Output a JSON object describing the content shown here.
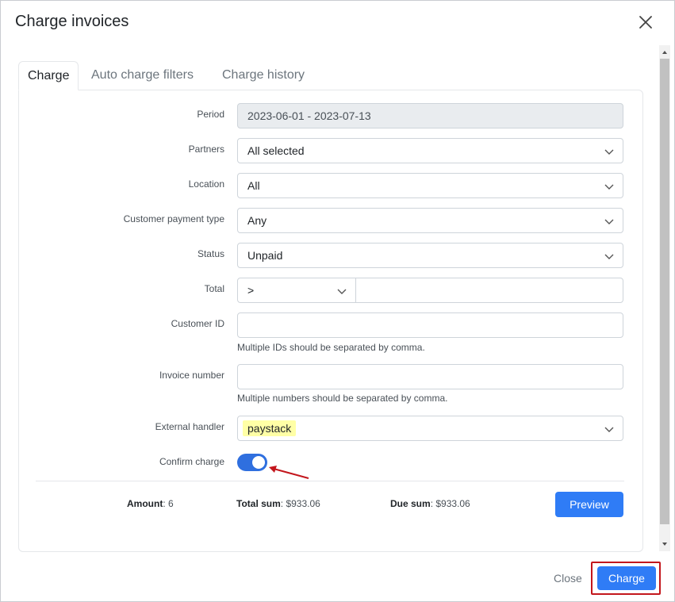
{
  "dialog": {
    "title": "Charge invoices",
    "close_icon": "close-icon"
  },
  "tabs": [
    {
      "label": "Charge",
      "active": true
    },
    {
      "label": "Auto charge filters",
      "active": false
    },
    {
      "label": "Charge history",
      "active": false
    }
  ],
  "form": {
    "period": {
      "label": "Period",
      "value": "2023-06-01 - 2023-07-13"
    },
    "partners": {
      "label": "Partners",
      "value": "All selected"
    },
    "location": {
      "label": "Location",
      "value": "All"
    },
    "payment_type": {
      "label": "Customer payment type",
      "value": "Any"
    },
    "status": {
      "label": "Status",
      "value": "Unpaid"
    },
    "total": {
      "label": "Total",
      "operator": ">",
      "value": ""
    },
    "customer_id": {
      "label": "Customer ID",
      "value": "",
      "help": "Multiple IDs should be separated by comma."
    },
    "invoice_number": {
      "label": "Invoice number",
      "value": "",
      "help": "Multiple numbers should be separated by comma."
    },
    "external_handler": {
      "label": "External handler",
      "value": "paystack"
    },
    "confirm_charge": {
      "label": "Confirm charge",
      "enabled": true
    }
  },
  "summary": {
    "amount_label": "Amount",
    "amount_value": ": 6",
    "total_label": "Total sum",
    "total_value": ": $933.06",
    "due_label": "Due sum",
    "due_value": ": $933.06"
  },
  "buttons": {
    "preview": "Preview",
    "close": "Close",
    "charge": "Charge"
  },
  "colors": {
    "primary": "#2f7cf6",
    "toggle_on": "#2f6fdf",
    "highlight": "#ffffa6",
    "annotation_red": "#c3161c"
  }
}
